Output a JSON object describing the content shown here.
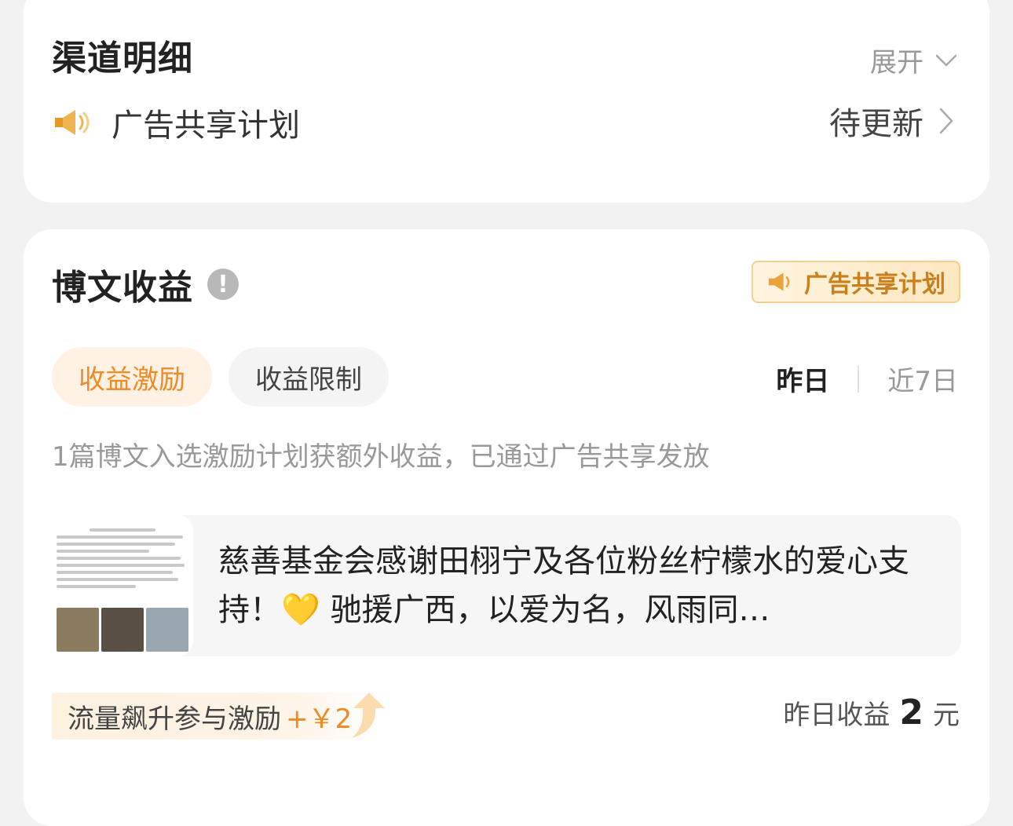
{
  "channel": {
    "title": "渠道明细",
    "expand_label": "展开",
    "icon": "megaphone-icon",
    "item_label": "广告共享计划",
    "item_status": "待更新"
  },
  "post_income": {
    "title": "博文收益",
    "badge_label": "广告共享计划",
    "tabs": [
      "收益激励",
      "收益限制"
    ],
    "active_tab": "收益激励",
    "periods": [
      "昨日",
      "近7日"
    ],
    "active_period": "昨日",
    "description": "1篇博文入选激励计划获额外收益，已通过广告共享发放",
    "post": {
      "title": "慈善基金会感谢田栩宁及各位粉丝柠檬水的爱心支持！💛 驰援广西，以爱为名，风雨同…"
    },
    "boost": {
      "label": "流量飙升参与激励",
      "amount": "+￥2"
    },
    "income": {
      "label": "昨日收益",
      "value": "2",
      "unit": "元"
    }
  },
  "colors": {
    "accent_orange": "#f08a22",
    "badge_text": "#c97f1c",
    "muted_text": "#999999"
  }
}
